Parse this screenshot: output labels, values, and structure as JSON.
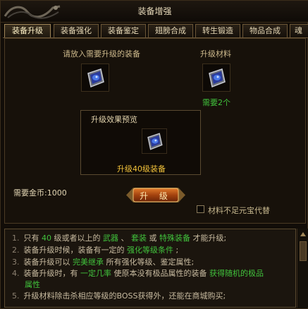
{
  "window": {
    "title": "装备增强"
  },
  "tabs": [
    {
      "label": "装备升级"
    },
    {
      "label": "装备强化"
    },
    {
      "label": "装备鉴定"
    },
    {
      "label": "翅膀合成"
    },
    {
      "label": "转生锻造"
    },
    {
      "label": "物品合成"
    },
    {
      "label": "魂"
    }
  ],
  "main": {
    "equip_prompt": "请放入需要升级的装备",
    "material_label": "升级材料",
    "material_need": "需要2个",
    "preview_title": "升级效果预览",
    "preview_item": "升级40级装备",
    "gold_label": "需要金币:1000",
    "upgrade_button": "升 级",
    "substitute_label": "材料不足元宝代替"
  },
  "info_lines": [
    {
      "n": "1.",
      "parts": [
        {
          "t": "只有 ",
          "c": "n"
        },
        {
          "t": "40",
          "c": "g"
        },
        {
          "t": " 级或者以上的 ",
          "c": "n"
        },
        {
          "t": "武器",
          "c": "g"
        },
        {
          "t": " 、 ",
          "c": "n"
        },
        {
          "t": "套装",
          "c": "g"
        },
        {
          "t": " 或 ",
          "c": "n"
        },
        {
          "t": "特殊装备",
          "c": "g"
        },
        {
          "t": " 才能升级;",
          "c": "n"
        }
      ]
    },
    {
      "n": "2.",
      "parts": [
        {
          "t": "装备升级时候，装备有一定的 ",
          "c": "n"
        },
        {
          "t": "强化等级条件",
          "c": "g"
        },
        {
          "t": " ;",
          "c": "n"
        }
      ]
    },
    {
      "n": "3.",
      "parts": [
        {
          "t": "装备升级可以 ",
          "c": "n"
        },
        {
          "t": "完美继承",
          "c": "g"
        },
        {
          "t": " 所有强化等级、鉴定属性;",
          "c": "n"
        }
      ]
    },
    {
      "n": "4.",
      "parts": [
        {
          "t": "装备升级时，有 ",
          "c": "n"
        },
        {
          "t": "一定几率",
          "c": "g"
        },
        {
          "t": " 使原本没有极品属性的装备 ",
          "c": "n"
        },
        {
          "t": "获得随机的极品",
          "c": "g"
        }
      ]
    },
    {
      "n": "",
      "parts": [
        {
          "t": "属性",
          "c": "g"
        }
      ]
    },
    {
      "n": "5.",
      "parts": [
        {
          "t": "升级材料除击杀相应等级的BOSS获得外，还能在商城购买;",
          "c": "n"
        }
      ]
    }
  ]
}
